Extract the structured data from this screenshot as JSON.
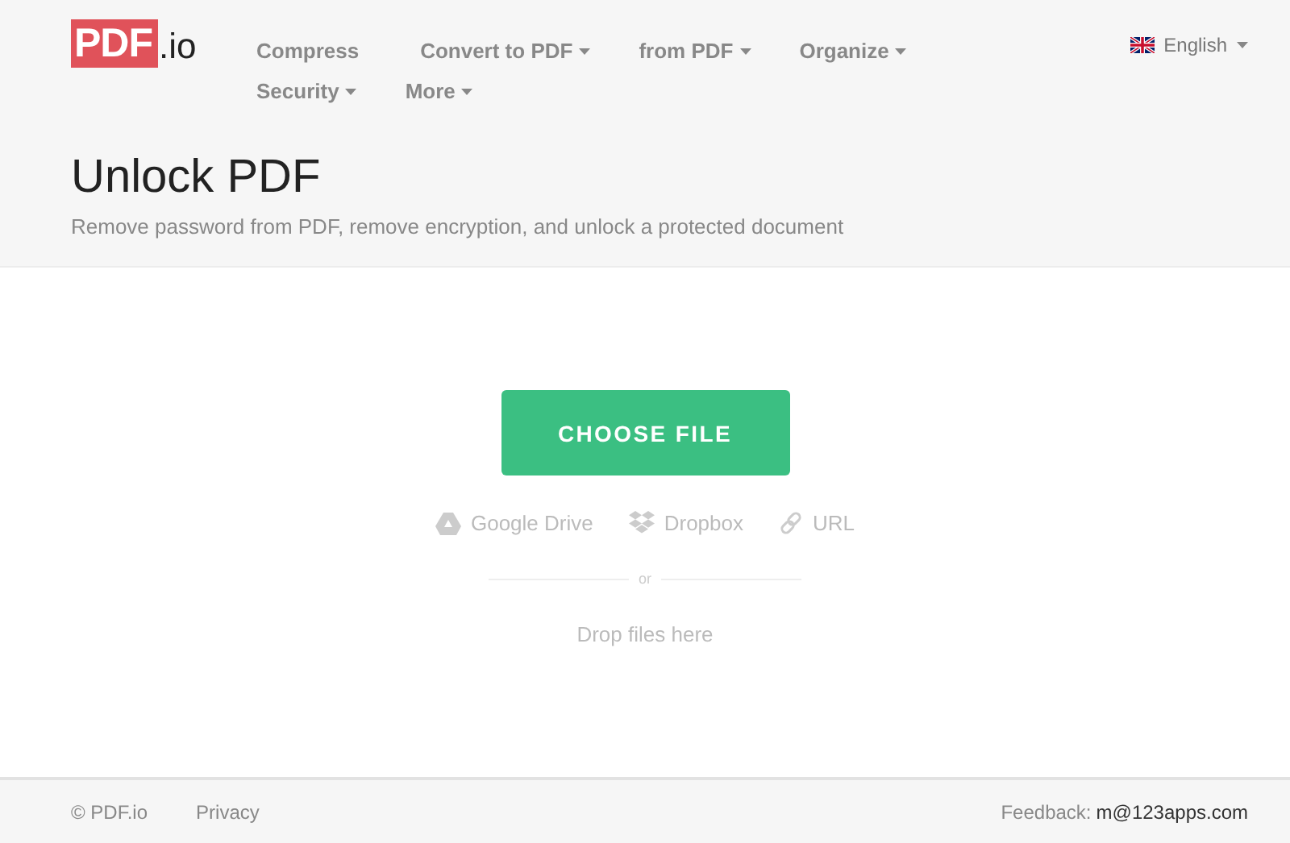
{
  "logo": {
    "mark": "PDF",
    "suffix": ".io"
  },
  "nav": [
    {
      "label": "Compress",
      "dropdown": false
    },
    {
      "label": "Convert to PDF",
      "dropdown": true
    },
    {
      "label": "from PDF",
      "dropdown": true
    },
    {
      "label": "Organize",
      "dropdown": true
    },
    {
      "label": "Security",
      "dropdown": true
    },
    {
      "label": "More",
      "dropdown": true
    }
  ],
  "language": {
    "label": "English"
  },
  "page": {
    "title": "Unlock PDF",
    "subtitle": "Remove password from PDF, remove encryption, and unlock a protected document"
  },
  "upload": {
    "button": "CHOOSE FILE",
    "sources": [
      {
        "kind": "drive",
        "label": "Google Drive"
      },
      {
        "kind": "dropbox",
        "label": "Dropbox"
      },
      {
        "kind": "url",
        "label": "URL"
      }
    ],
    "separator": "or",
    "drop_hint": "Drop files here"
  },
  "footer": {
    "copyright": "© PDF.io",
    "privacy": "Privacy",
    "feedback_label": "Feedback:",
    "feedback_email": "m@123apps.com"
  }
}
